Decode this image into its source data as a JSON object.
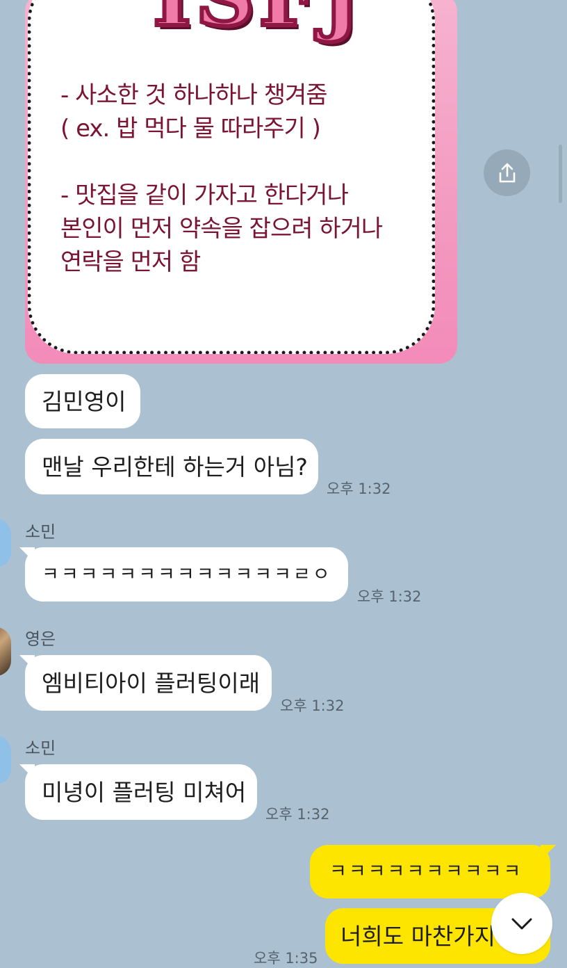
{
  "shared_image": {
    "title": "ISFJ",
    "lines": [
      "- 사소한 것 하나하나 챙겨줌",
      "( ex. 밥 먹다 물 따라주기 )",
      "",
      "- 맛집을 같이 가자고 한다거나",
      "본인이 먼저 약속을 잡으려 하거나",
      "연락을 먼저 함"
    ]
  },
  "messages": [
    {
      "text": "김민영이"
    },
    {
      "text": "맨날 우리한테 하는거 아님?",
      "time": "오후 1:32"
    },
    {
      "sender": "소민",
      "text": "ㅋㅋㅋㅋㅋㅋㅋㅋㅋㅋㅋㅋㅋㄹㅇ",
      "time": "오후 1:32"
    },
    {
      "sender": "영은",
      "text": "엠비티아이 플러팅이래",
      "time": "오후 1:32"
    },
    {
      "sender": "소민",
      "text": "미녕이 플러팅 미쳐어",
      "time": "오후 1:32"
    },
    {
      "text": "ㅋㅋㅋㅋㅋㅋㅋㅋㅋㅋ",
      "mine": true
    },
    {
      "text": "너희도 마찬가지야 ㅎ",
      "mine": true,
      "time": "오후 1:35"
    }
  ],
  "icons": {
    "share": "share-icon",
    "scroll_down": "chevron-down-icon"
  },
  "colors": {
    "background": "#abc1d1",
    "my_bubble": "#fee500",
    "other_bubble": "#ffffff"
  }
}
